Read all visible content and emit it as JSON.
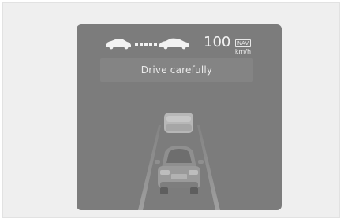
{
  "cluster": {
    "speed_value": "100",
    "speed_unit": "km/h",
    "nav_badge": "NAV",
    "message": "Drive carefully"
  },
  "colors": {
    "screen_background": "#7c7c7c",
    "message_bar": "#848484",
    "text": "#eaeaea"
  },
  "icons": [
    "distance-gap-icon",
    "lead-vehicle-icon",
    "own-vehicle-icon"
  ]
}
